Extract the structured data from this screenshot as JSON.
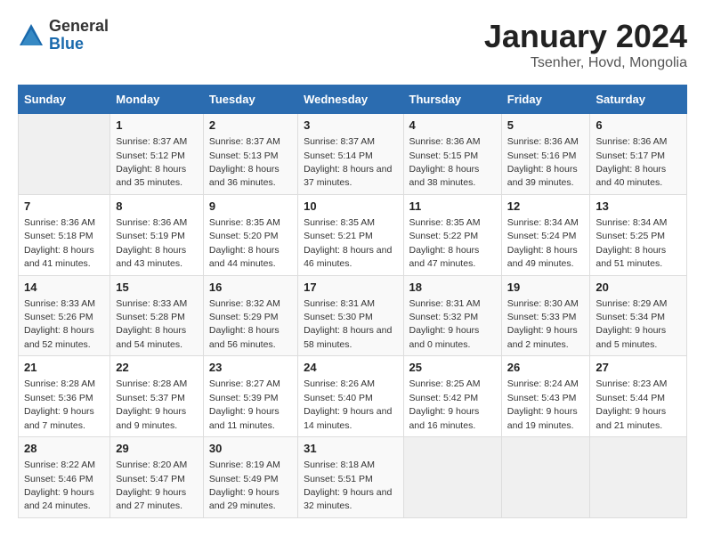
{
  "logo": {
    "general": "General",
    "blue": "Blue"
  },
  "title": {
    "month": "January 2024",
    "location": "Tsenher, Hovd, Mongolia"
  },
  "headers": [
    "Sunday",
    "Monday",
    "Tuesday",
    "Wednesday",
    "Thursday",
    "Friday",
    "Saturday"
  ],
  "weeks": [
    [
      {
        "day": "",
        "sunrise": "",
        "sunset": "",
        "daylight": ""
      },
      {
        "day": "1",
        "sunrise": "Sunrise: 8:37 AM",
        "sunset": "Sunset: 5:12 PM",
        "daylight": "Daylight: 8 hours and 35 minutes."
      },
      {
        "day": "2",
        "sunrise": "Sunrise: 8:37 AM",
        "sunset": "Sunset: 5:13 PM",
        "daylight": "Daylight: 8 hours and 36 minutes."
      },
      {
        "day": "3",
        "sunrise": "Sunrise: 8:37 AM",
        "sunset": "Sunset: 5:14 PM",
        "daylight": "Daylight: 8 hours and 37 minutes."
      },
      {
        "day": "4",
        "sunrise": "Sunrise: 8:36 AM",
        "sunset": "Sunset: 5:15 PM",
        "daylight": "Daylight: 8 hours and 38 minutes."
      },
      {
        "day": "5",
        "sunrise": "Sunrise: 8:36 AM",
        "sunset": "Sunset: 5:16 PM",
        "daylight": "Daylight: 8 hours and 39 minutes."
      },
      {
        "day": "6",
        "sunrise": "Sunrise: 8:36 AM",
        "sunset": "Sunset: 5:17 PM",
        "daylight": "Daylight: 8 hours and 40 minutes."
      }
    ],
    [
      {
        "day": "7",
        "sunrise": "Sunrise: 8:36 AM",
        "sunset": "Sunset: 5:18 PM",
        "daylight": "Daylight: 8 hours and 41 minutes."
      },
      {
        "day": "8",
        "sunrise": "Sunrise: 8:36 AM",
        "sunset": "Sunset: 5:19 PM",
        "daylight": "Daylight: 8 hours and 43 minutes."
      },
      {
        "day": "9",
        "sunrise": "Sunrise: 8:35 AM",
        "sunset": "Sunset: 5:20 PM",
        "daylight": "Daylight: 8 hours and 44 minutes."
      },
      {
        "day": "10",
        "sunrise": "Sunrise: 8:35 AM",
        "sunset": "Sunset: 5:21 PM",
        "daylight": "Daylight: 8 hours and 46 minutes."
      },
      {
        "day": "11",
        "sunrise": "Sunrise: 8:35 AM",
        "sunset": "Sunset: 5:22 PM",
        "daylight": "Daylight: 8 hours and 47 minutes."
      },
      {
        "day": "12",
        "sunrise": "Sunrise: 8:34 AM",
        "sunset": "Sunset: 5:24 PM",
        "daylight": "Daylight: 8 hours and 49 minutes."
      },
      {
        "day": "13",
        "sunrise": "Sunrise: 8:34 AM",
        "sunset": "Sunset: 5:25 PM",
        "daylight": "Daylight: 8 hours and 51 minutes."
      }
    ],
    [
      {
        "day": "14",
        "sunrise": "Sunrise: 8:33 AM",
        "sunset": "Sunset: 5:26 PM",
        "daylight": "Daylight: 8 hours and 52 minutes."
      },
      {
        "day": "15",
        "sunrise": "Sunrise: 8:33 AM",
        "sunset": "Sunset: 5:28 PM",
        "daylight": "Daylight: 8 hours and 54 minutes."
      },
      {
        "day": "16",
        "sunrise": "Sunrise: 8:32 AM",
        "sunset": "Sunset: 5:29 PM",
        "daylight": "Daylight: 8 hours and 56 minutes."
      },
      {
        "day": "17",
        "sunrise": "Sunrise: 8:31 AM",
        "sunset": "Sunset: 5:30 PM",
        "daylight": "Daylight: 8 hours and 58 minutes."
      },
      {
        "day": "18",
        "sunrise": "Sunrise: 8:31 AM",
        "sunset": "Sunset: 5:32 PM",
        "daylight": "Daylight: 9 hours and 0 minutes."
      },
      {
        "day": "19",
        "sunrise": "Sunrise: 8:30 AM",
        "sunset": "Sunset: 5:33 PM",
        "daylight": "Daylight: 9 hours and 2 minutes."
      },
      {
        "day": "20",
        "sunrise": "Sunrise: 8:29 AM",
        "sunset": "Sunset: 5:34 PM",
        "daylight": "Daylight: 9 hours and 5 minutes."
      }
    ],
    [
      {
        "day": "21",
        "sunrise": "Sunrise: 8:28 AM",
        "sunset": "Sunset: 5:36 PM",
        "daylight": "Daylight: 9 hours and 7 minutes."
      },
      {
        "day": "22",
        "sunrise": "Sunrise: 8:28 AM",
        "sunset": "Sunset: 5:37 PM",
        "daylight": "Daylight: 9 hours and 9 minutes."
      },
      {
        "day": "23",
        "sunrise": "Sunrise: 8:27 AM",
        "sunset": "Sunset: 5:39 PM",
        "daylight": "Daylight: 9 hours and 11 minutes."
      },
      {
        "day": "24",
        "sunrise": "Sunrise: 8:26 AM",
        "sunset": "Sunset: 5:40 PM",
        "daylight": "Daylight: 9 hours and 14 minutes."
      },
      {
        "day": "25",
        "sunrise": "Sunrise: 8:25 AM",
        "sunset": "Sunset: 5:42 PM",
        "daylight": "Daylight: 9 hours and 16 minutes."
      },
      {
        "day": "26",
        "sunrise": "Sunrise: 8:24 AM",
        "sunset": "Sunset: 5:43 PM",
        "daylight": "Daylight: 9 hours and 19 minutes."
      },
      {
        "day": "27",
        "sunrise": "Sunrise: 8:23 AM",
        "sunset": "Sunset: 5:44 PM",
        "daylight": "Daylight: 9 hours and 21 minutes."
      }
    ],
    [
      {
        "day": "28",
        "sunrise": "Sunrise: 8:22 AM",
        "sunset": "Sunset: 5:46 PM",
        "daylight": "Daylight: 9 hours and 24 minutes."
      },
      {
        "day": "29",
        "sunrise": "Sunrise: 8:20 AM",
        "sunset": "Sunset: 5:47 PM",
        "daylight": "Daylight: 9 hours and 27 minutes."
      },
      {
        "day": "30",
        "sunrise": "Sunrise: 8:19 AM",
        "sunset": "Sunset: 5:49 PM",
        "daylight": "Daylight: 9 hours and 29 minutes."
      },
      {
        "day": "31",
        "sunrise": "Sunrise: 8:18 AM",
        "sunset": "Sunset: 5:51 PM",
        "daylight": "Daylight: 9 hours and 32 minutes."
      },
      {
        "day": "",
        "sunrise": "",
        "sunset": "",
        "daylight": ""
      },
      {
        "day": "",
        "sunrise": "",
        "sunset": "",
        "daylight": ""
      },
      {
        "day": "",
        "sunrise": "",
        "sunset": "",
        "daylight": ""
      }
    ]
  ]
}
